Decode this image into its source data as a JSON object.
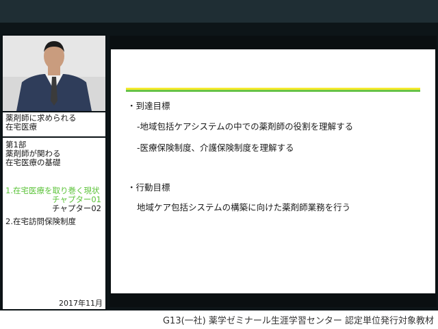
{
  "sidebar": {
    "course_title_line1": "薬剤師に求められる",
    "course_title_line2": "在宅医療",
    "part_line1": "第1部",
    "part_line2": "薬剤師が関わる",
    "part_line3": "在宅医療の基礎",
    "section1": "1.在宅医療を取り巻く現状",
    "chapter1": "チャプター01",
    "chapter2": "チャプター02",
    "section2": "2.在宅訪問保険制度",
    "date": "2017年11月"
  },
  "slide": {
    "bullet1_title": "到達目標",
    "bullet1_item1": "-地域包括ケアシステムの中での薬剤師の役割を理解する",
    "bullet1_item2": "-医療保険制度、介護保険制度を理解する",
    "bullet2_title": "行動目標",
    "bullet2_item1": "地域ケア包括システムの構築に向けた薬剤師業務を行う"
  },
  "footer": {
    "text": "G13(一社) 薬学ゼミナール生涯学習センター 認定単位発行対象教材"
  },
  "colors": {
    "active_green": "#5cc33a",
    "rule_yellow": "#f3ea2d",
    "rule_green": "#66c346"
  }
}
